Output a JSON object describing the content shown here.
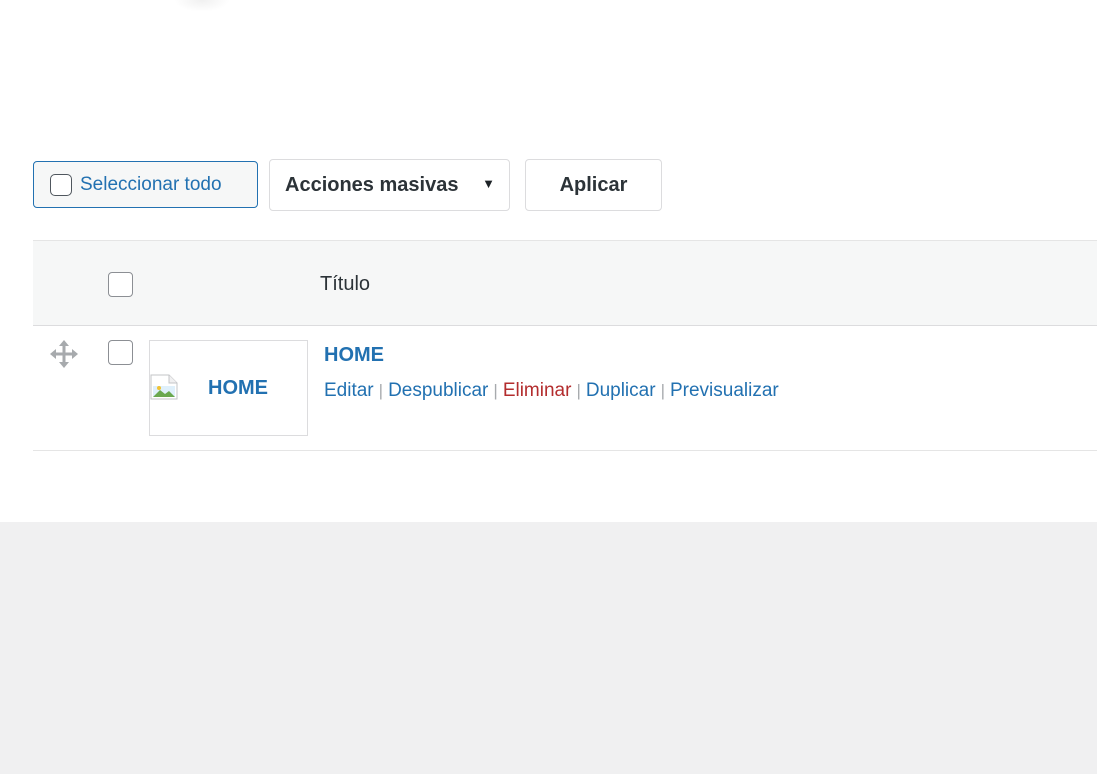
{
  "toolbar": {
    "select_all_label": "Seleccionar todo",
    "bulk_actions": {
      "selected": "Acciones masivas",
      "caret": "▼"
    },
    "apply_label": "Aplicar"
  },
  "table": {
    "columns": {
      "title": "Título"
    },
    "rows": [
      {
        "thumbnail_alt": "HOME",
        "title": "HOME",
        "actions": {
          "edit": "Editar",
          "unpublish": "Despublicar",
          "delete": "Eliminar",
          "duplicate": "Duplicar",
          "preview": "Previsualizar"
        },
        "separator": "|"
      }
    ]
  },
  "colors": {
    "link": "#2271b1",
    "danger": "#b32d2e",
    "background": "#f0f0f1",
    "panel": "#ffffff"
  },
  "icons": {
    "drag_handle": "move-arrows-icon",
    "thumbnail_placeholder": "broken-image-icon"
  }
}
